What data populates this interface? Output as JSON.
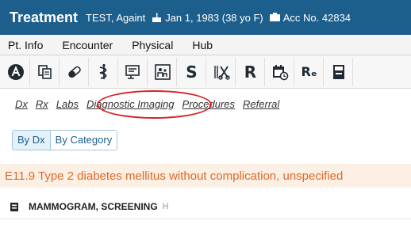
{
  "header": {
    "title": "Treatment",
    "patient": "TEST, Againt",
    "dob": "Jan 1, 1983 (38 yo F)",
    "account": "Acc No. 42834"
  },
  "menu": [
    "Pt. Info",
    "Encounter",
    "Physical",
    "Hub"
  ],
  "toolbar": {
    "glyph_s": "S",
    "glyph_r": "R",
    "glyph_re": "Rₑ",
    "icons": [
      "a-circle-icon",
      "copy-icon",
      "pill-icon",
      "caduceus-icon",
      "monitor-icon",
      "family-icon",
      "s-icon",
      "scissors-icon",
      "r-icon",
      "calendar-icon",
      "re-icon",
      "print-icon"
    ]
  },
  "links": [
    "Dx",
    "Rx",
    "Labs",
    "Diagnostic Imaging",
    "Procedures",
    "Referral"
  ],
  "filter": {
    "by_dx": "By Dx",
    "by_category": "By Category",
    "selected": "By Dx"
  },
  "diagnosis": "E11.9 Type 2 diabetes mellitus without complication, unspecified",
  "order": {
    "name": "MAMMOGRAM, SCREENING",
    "flag": "H"
  },
  "colors": {
    "header_bg": "#1d5f8c",
    "diagnosis_text": "#e0692a",
    "diagnosis_bg": "#fcefe3",
    "annotation": "#d61f26"
  }
}
